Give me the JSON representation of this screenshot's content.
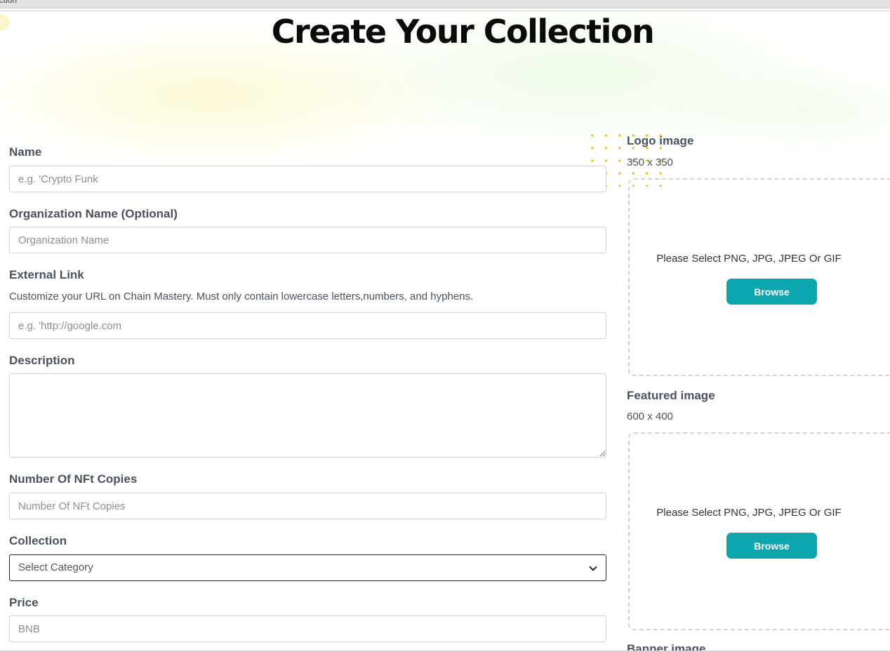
{
  "browser": {
    "tab_fragment": "ection"
  },
  "page": {
    "title": "Create Your Collection"
  },
  "form": {
    "name": {
      "label": "Name",
      "placeholder": "e.g. 'Crypto Funk"
    },
    "organization": {
      "label": "Organization Name (Optional)",
      "placeholder": "Organization Name"
    },
    "external_link": {
      "label": "External Link",
      "help": "Customize your URL on Chain Mastery. Must only contain lowercase letters,numbers, and hyphens.",
      "placeholder": "e.g. 'http://google.com"
    },
    "description": {
      "label": "Description",
      "value": ""
    },
    "copies": {
      "label": "Number Of NFt Copies",
      "placeholder": "Number Of NFt Copies"
    },
    "collection": {
      "label": "Collection",
      "selected": "Select Category"
    },
    "price": {
      "label": "Price",
      "placeholder": "BNB"
    }
  },
  "uploads": {
    "logo": {
      "label": "Logo image",
      "size": "350 x 350",
      "message": "Please Select PNG, JPG, JPEG Or GIF",
      "button": "Browse"
    },
    "featured": {
      "label": "Featured image",
      "size": "600 x 400",
      "message": "Please Select PNG, JPG, JPEG Or GIF",
      "button": "Browse"
    },
    "banner": {
      "label": "Banner image"
    }
  },
  "colors": {
    "accent": "#0ba6ae",
    "title": "#0b0b0b",
    "label": "#4a5160",
    "dots": "#f5c51a"
  }
}
